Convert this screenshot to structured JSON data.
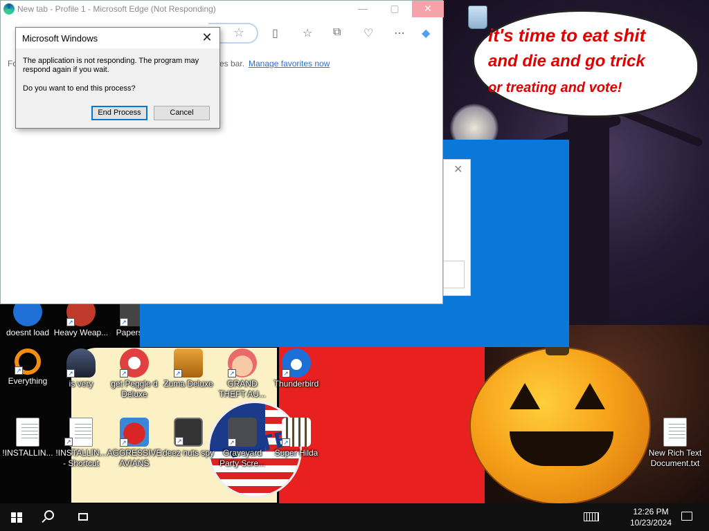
{
  "edge_window": {
    "title": "New tab - Profile 1 - Microsoft Edge (Not Responding)",
    "favorites_prefix": "Fo",
    "favorites_mid": "es bar.",
    "favorites_link": "Manage favorites now"
  },
  "dialog": {
    "title": "Microsoft Windows",
    "message": "The application is not responding. The program may respond again if you wait.",
    "question": "Do you want to end this process?",
    "end_process_label": "End Process",
    "cancel_label": "Cancel"
  },
  "speech_bubble": {
    "line1": "it's time to eat shit",
    "line2": "and die and go trick",
    "line3": "or treating and vote!"
  },
  "vote_badge": "VOTE",
  "desktop_icons": [
    {
      "label": "doesnt load",
      "icon": "app-icon"
    },
    {
      "label": "Heavy Weap...",
      "icon": "app-icon"
    },
    {
      "label": "Papers, P",
      "icon": "app-icon"
    },
    {
      "label": "Everything",
      "icon": "everything-icon"
    },
    {
      "label": "is very",
      "icon": "app-icon"
    },
    {
      "label": "get Peggle d Deluxe",
      "icon": "peggle-icon"
    },
    {
      "label": "Zuma Deluxe",
      "icon": "zuma-icon"
    },
    {
      "label": "GRAND THEFT AU...",
      "icon": "app-icon"
    },
    {
      "label": "Thunderbird",
      "icon": "thunderbird-icon"
    },
    {
      "label": "!INSTALLIN...",
      "icon": "document-icon"
    },
    {
      "label": "!INSTALLIN... - Shortcut",
      "icon": "document-icon"
    },
    {
      "label": "AGGRESSIVE AVIANS",
      "icon": "angry-birds-icon"
    },
    {
      "label": "deez nuts spy",
      "icon": "app-icon"
    },
    {
      "label": "Graveyard Party Scre...",
      "icon": "app-icon"
    },
    {
      "label": "Super Hilda",
      "icon": "app-icon"
    },
    {
      "label": "New Rich Text Document.txt",
      "icon": "document-icon"
    }
  ],
  "taskbar": {
    "time": "12:26 PM",
    "date": "10/23/2024"
  },
  "colors": {
    "accent_blue": "#0b78d8",
    "speech_red": "#e00000",
    "link_blue": "#2b6fce",
    "taskbar": "#101010"
  }
}
